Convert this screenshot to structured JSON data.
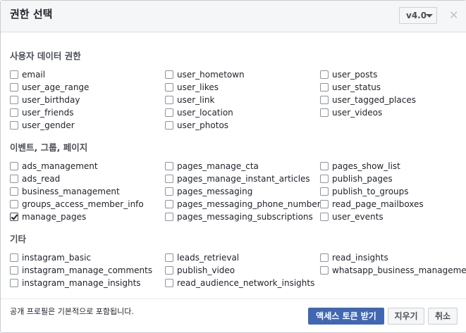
{
  "header": {
    "title": "권한 선택",
    "version_label": "v4.0",
    "close_label": "✕"
  },
  "sections": [
    {
      "title": "사용자 데이터 권한",
      "items": [
        {
          "label": "email",
          "checked": false
        },
        {
          "label": "user_hometown",
          "checked": false
        },
        {
          "label": "user_posts",
          "checked": false
        },
        {
          "label": "user_age_range",
          "checked": false
        },
        {
          "label": "user_likes",
          "checked": false
        },
        {
          "label": "user_status",
          "checked": false
        },
        {
          "label": "user_birthday",
          "checked": false
        },
        {
          "label": "user_link",
          "checked": false
        },
        {
          "label": "user_tagged_places",
          "checked": false
        },
        {
          "label": "user_friends",
          "checked": false
        },
        {
          "label": "user_location",
          "checked": false
        },
        {
          "label": "user_videos",
          "checked": false
        },
        {
          "label": "user_gender",
          "checked": false
        },
        {
          "label": "user_photos",
          "checked": false
        }
      ]
    },
    {
      "title": "이벤트, 그룹, 페이지",
      "items": [
        {
          "label": "ads_management",
          "checked": false
        },
        {
          "label": "pages_manage_cta",
          "checked": false
        },
        {
          "label": "pages_show_list",
          "checked": false
        },
        {
          "label": "ads_read",
          "checked": false
        },
        {
          "label": "pages_manage_instant_articles",
          "checked": false
        },
        {
          "label": "publish_pages",
          "checked": false
        },
        {
          "label": "business_management",
          "checked": false
        },
        {
          "label": "pages_messaging",
          "checked": false
        },
        {
          "label": "publish_to_groups",
          "checked": false
        },
        {
          "label": "groups_access_member_info",
          "checked": false
        },
        {
          "label": "pages_messaging_phone_number",
          "checked": false
        },
        {
          "label": "read_page_mailboxes",
          "checked": false
        },
        {
          "label": "manage_pages",
          "checked": true
        },
        {
          "label": "pages_messaging_subscriptions",
          "checked": false
        },
        {
          "label": "user_events",
          "checked": false
        }
      ]
    },
    {
      "title": "기타",
      "items": [
        {
          "label": "instagram_basic",
          "checked": false
        },
        {
          "label": "leads_retrieval",
          "checked": false
        },
        {
          "label": "read_insights",
          "checked": false
        },
        {
          "label": "instagram_manage_comments",
          "checked": false
        },
        {
          "label": "publish_video",
          "checked": false
        },
        {
          "label": "whatsapp_business_management",
          "checked": false
        },
        {
          "label": "instagram_manage_insights",
          "checked": false
        },
        {
          "label": "read_audience_network_insights",
          "checked": false
        }
      ]
    }
  ],
  "footer": {
    "note": "공개 프로필은 기본적으로 포함됩니다.",
    "get_token_label": "액세스 토큰 받기",
    "clear_label": "지우기",
    "cancel_label": "취소"
  }
}
